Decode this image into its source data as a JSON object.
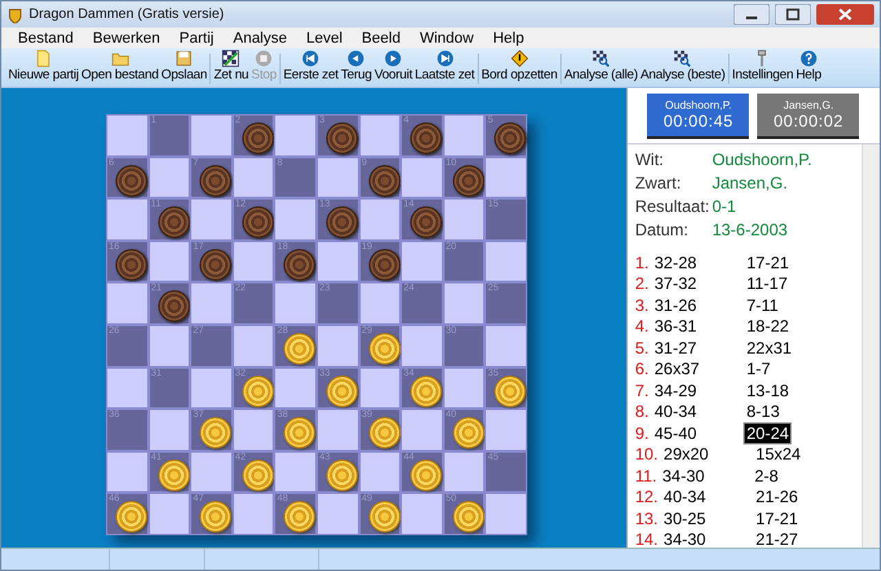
{
  "window": {
    "title": "Dragon Dammen (Gratis versie)"
  },
  "menu": [
    "Bestand",
    "Bewerken",
    "Partij",
    "Analyse",
    "Level",
    "Beeld",
    "Window",
    "Help"
  ],
  "toolbar": [
    {
      "label": "Nieuwe partij",
      "kind": "new",
      "disabled": false,
      "sep": false
    },
    {
      "label": "Open bestand",
      "kind": "open",
      "disabled": false,
      "sep": false
    },
    {
      "label": "Opslaan",
      "kind": "save",
      "disabled": false,
      "sep": true
    },
    {
      "label": "Zet nu",
      "kind": "move",
      "disabled": false,
      "sep": false
    },
    {
      "label": "Stop",
      "kind": "stop",
      "disabled": true,
      "sep": true
    },
    {
      "label": "Eerste zet",
      "kind": "first",
      "disabled": false,
      "sep": false
    },
    {
      "label": "Terug",
      "kind": "back",
      "disabled": false,
      "sep": false
    },
    {
      "label": "Vooruit",
      "kind": "forward",
      "disabled": false,
      "sep": false
    },
    {
      "label": "Laatste zet",
      "kind": "last",
      "disabled": false,
      "sep": true
    },
    {
      "label": "Bord opzetten",
      "kind": "setup",
      "disabled": false,
      "sep": true
    },
    {
      "label": "Analyse (alle)",
      "kind": "analyze",
      "disabled": false,
      "sep": false
    },
    {
      "label": "Analyse (beste)",
      "kind": "analyze",
      "disabled": false,
      "sep": true
    },
    {
      "label": "Instellingen",
      "kind": "settings",
      "disabled": false,
      "sep": false
    },
    {
      "label": "Help",
      "kind": "help",
      "disabled": false,
      "sep": false
    }
  ],
  "board": {
    "squares": [
      {
        "number": "1",
        "kind": "none"
      },
      {
        "number": "2",
        "kind": "black"
      },
      {
        "number": "3",
        "kind": "black"
      },
      {
        "number": "4",
        "kind": "black"
      },
      {
        "number": "5",
        "kind": "black"
      },
      {
        "number": "6",
        "kind": "black"
      },
      {
        "number": "7",
        "kind": "black"
      },
      {
        "number": "8",
        "kind": "none"
      },
      {
        "number": "9",
        "kind": "black"
      },
      {
        "number": "10",
        "kind": "black"
      },
      {
        "number": "11",
        "kind": "black"
      },
      {
        "number": "12",
        "kind": "black"
      },
      {
        "number": "13",
        "kind": "black"
      },
      {
        "number": "14",
        "kind": "black"
      },
      {
        "number": "15",
        "kind": "none"
      },
      {
        "number": "16",
        "kind": "black"
      },
      {
        "number": "17",
        "kind": "black"
      },
      {
        "number": "18",
        "kind": "black"
      },
      {
        "number": "19",
        "kind": "black"
      },
      {
        "number": "20",
        "kind": "none"
      },
      {
        "number": "21",
        "kind": "black"
      },
      {
        "number": "22",
        "kind": "none"
      },
      {
        "number": "23",
        "kind": "none"
      },
      {
        "number": "24",
        "kind": "none"
      },
      {
        "number": "25",
        "kind": "none"
      },
      {
        "number": "26",
        "kind": "none"
      },
      {
        "number": "27",
        "kind": "none"
      },
      {
        "number": "28",
        "kind": "white"
      },
      {
        "number": "29",
        "kind": "white"
      },
      {
        "number": "30",
        "kind": "none"
      },
      {
        "number": "31",
        "kind": "none"
      },
      {
        "number": "32",
        "kind": "white"
      },
      {
        "number": "33",
        "kind": "white"
      },
      {
        "number": "34",
        "kind": "white"
      },
      {
        "number": "35",
        "kind": "white"
      },
      {
        "number": "36",
        "kind": "none"
      },
      {
        "number": "37",
        "kind": "white"
      },
      {
        "number": "38",
        "kind": "white"
      },
      {
        "number": "39",
        "kind": "white"
      },
      {
        "number": "40",
        "kind": "white"
      },
      {
        "number": "41",
        "kind": "white"
      },
      {
        "number": "42",
        "kind": "white"
      },
      {
        "number": "43",
        "kind": "white"
      },
      {
        "number": "44",
        "kind": "white"
      },
      {
        "number": "45",
        "kind": "none"
      },
      {
        "number": "46",
        "kind": "white"
      },
      {
        "number": "47",
        "kind": "white"
      },
      {
        "number": "48",
        "kind": "white"
      },
      {
        "number": "49",
        "kind": "white"
      },
      {
        "number": "50",
        "kind": "white"
      }
    ]
  },
  "clocks": [
    {
      "player": "Oudshoorn,P.",
      "time": "00:00:45",
      "selected": true
    },
    {
      "player": "Jansen,G.",
      "time": "00:00:02",
      "selected": false
    }
  ],
  "game_info": [
    {
      "label": "Wit:",
      "value": "Oudshoorn,P."
    },
    {
      "label": "Zwart:",
      "value": "Jansen,G."
    },
    {
      "label": "Resultaat:",
      "value": "0-1"
    },
    {
      "label": "Datum:",
      "value": "13-6-2003"
    }
  ],
  "moves": [
    {
      "number": "1.",
      "white": "32-28",
      "black": "17-21",
      "selected": false
    },
    {
      "number": "2.",
      "white": "37-32",
      "black": "11-17",
      "selected": false
    },
    {
      "number": "3.",
      "white": "31-26",
      "black": "7-11",
      "selected": false
    },
    {
      "number": "4.",
      "white": "36-31",
      "black": "18-22",
      "selected": false
    },
    {
      "number": "5.",
      "white": "31-27",
      "black": "22x31",
      "selected": false
    },
    {
      "number": "6.",
      "white": "26x37",
      "black": "1-7",
      "selected": false
    },
    {
      "number": "7.",
      "white": "34-29",
      "black": "13-18",
      "selected": false
    },
    {
      "number": "8.",
      "white": "40-34",
      "black": "8-13",
      "selected": false
    },
    {
      "number": "9.",
      "white": "45-40",
      "black": "20-24",
      "selected": true
    },
    {
      "number": "10.",
      "white": "29x20",
      "black": "15x24",
      "selected": false
    },
    {
      "number": "11.",
      "white": "34-30",
      "black": "2-8",
      "selected": false
    },
    {
      "number": "12.",
      "white": "40-34",
      "black": "21-26",
      "selected": false
    },
    {
      "number": "13.",
      "white": "30-25",
      "black": "17-21",
      "selected": false
    },
    {
      "number": "14.",
      "white": "34-30",
      "black": "21-27",
      "selected": false
    }
  ]
}
